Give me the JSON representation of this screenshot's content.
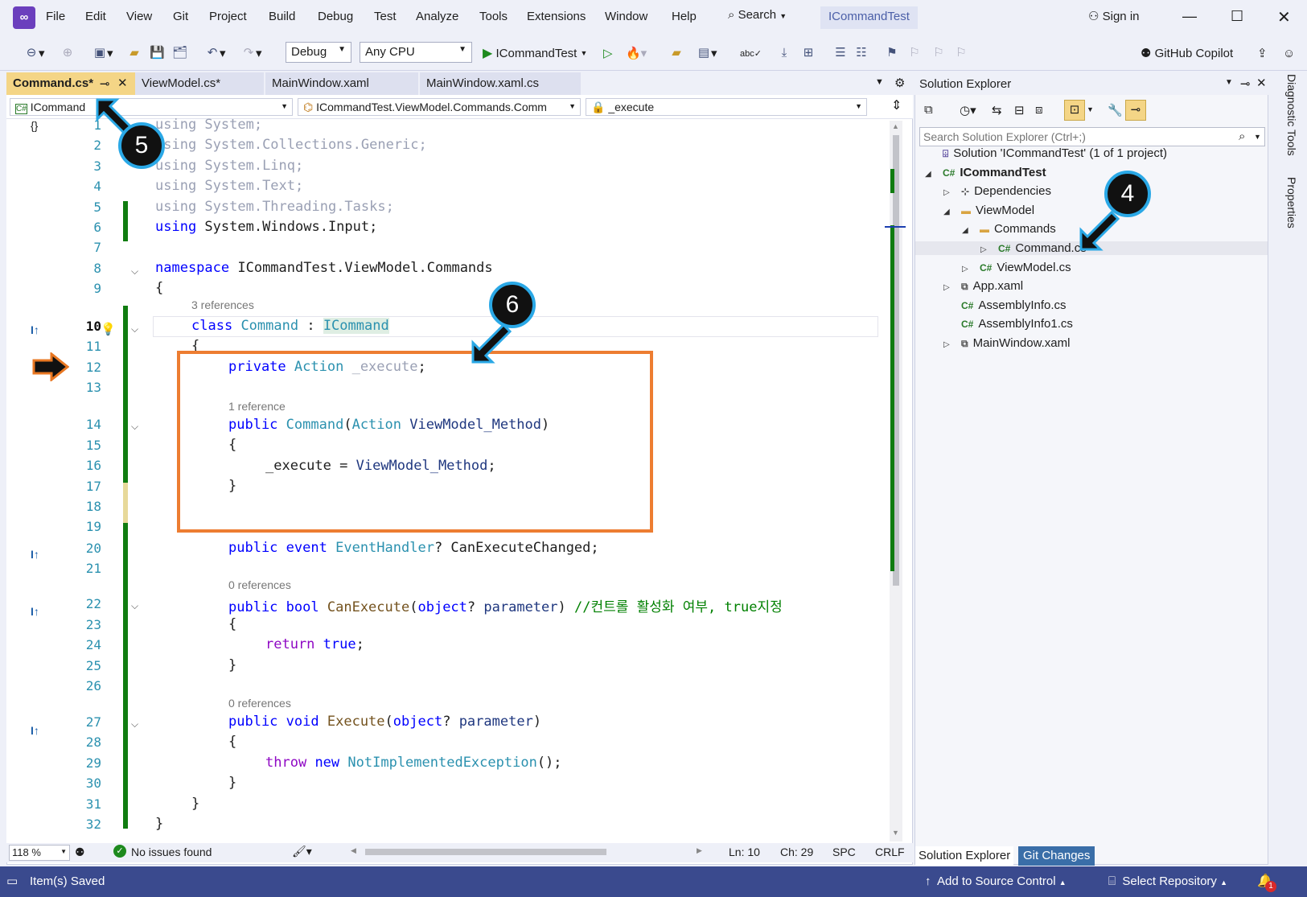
{
  "menu": [
    "File",
    "Edit",
    "View",
    "Git",
    "Project",
    "Build",
    "Debug",
    "Test",
    "Analyze",
    "Tools",
    "Extensions",
    "Window",
    "Help"
  ],
  "search_label": "Search",
  "project_title": "ICommandTest",
  "sign_in": "Sign in",
  "toolbar": {
    "config": "Debug",
    "platform": "Any CPU",
    "run_target": "ICommandTest",
    "copilot": "GitHub Copilot"
  },
  "tabs": [
    {
      "label": "Command.cs*",
      "active": true
    },
    {
      "label": "ViewModel.cs*",
      "active": false
    },
    {
      "label": "MainWindow.xaml",
      "active": false
    },
    {
      "label": "MainWindow.xaml.cs",
      "active": false
    }
  ],
  "navbar": {
    "project": "ICommand",
    "type": "ICommandTest.ViewModel.Commands.Comm",
    "member": "_execute"
  },
  "code": {
    "line_numbers": [
      "1",
      "2",
      "3",
      "4",
      "5",
      "6",
      "7",
      "8",
      "9",
      "10",
      "11",
      "12",
      "13",
      "14",
      "15",
      "16",
      "17",
      "18",
      "19",
      "20",
      "21",
      "22",
      "23",
      "24",
      "25",
      "26",
      "27",
      "28",
      "29",
      "30",
      "31",
      "32"
    ],
    "refs": {
      "class": "3 references",
      "ctor": "1 reference",
      "canexec": "0 references",
      "exec": "0 references"
    },
    "comment": "//컨트롤 활성화 여부, true지정"
  },
  "editor_status": {
    "zoom": "118 %",
    "issues": "No issues found",
    "ln": "Ln: 10",
    "ch": "Ch: 29",
    "spc": "SPC",
    "crlf": "CRLF"
  },
  "solution_explorer": {
    "title": "Solution Explorer",
    "search_placeholder": "Search Solution Explorer (Ctrl+;)",
    "items": [
      {
        "label": "Solution 'ICommandTest' (1 of 1 project)",
        "indent": 0,
        "icon": "solution-icon",
        "toggle": ""
      },
      {
        "label": "ICommandTest",
        "indent": 0,
        "icon": "csproj-icon",
        "toggle": "◢",
        "bold": true
      },
      {
        "label": "Dependencies",
        "indent": 1,
        "icon": "dependencies-icon",
        "toggle": "▷"
      },
      {
        "label": "ViewModel",
        "indent": 1,
        "icon": "folder-icon",
        "toggle": "◢"
      },
      {
        "label": "Commands",
        "indent": 2,
        "icon": "folder-icon",
        "toggle": "◢"
      },
      {
        "label": "Command.cs",
        "indent": 3,
        "icon": "csharp-file-icon",
        "toggle": "▷",
        "selected": true
      },
      {
        "label": "ViewModel.cs",
        "indent": 2,
        "icon": "csharp-file-icon",
        "toggle": "▷"
      },
      {
        "label": "App.xaml",
        "indent": 1,
        "icon": "xaml-file-icon",
        "toggle": "▷"
      },
      {
        "label": "AssemblyInfo.cs",
        "indent": 1,
        "icon": "csharp-file-icon",
        "toggle": ""
      },
      {
        "label": "AssemblyInfo1.cs",
        "indent": 1,
        "icon": "csharp-file-icon",
        "toggle": ""
      },
      {
        "label": "MainWindow.xaml",
        "indent": 1,
        "icon": "xaml-file-icon",
        "toggle": "▷"
      }
    ],
    "bottom_tabs": [
      "Solution Explorer",
      "Git Changes"
    ]
  },
  "side_tabs": [
    "Diagnostic Tools",
    "Properties"
  ],
  "status_bar": {
    "left": "Item(s) Saved",
    "source_control": "Add to Source Control",
    "repo": "Select Repository",
    "notifications": "1"
  },
  "callouts": [
    "5",
    "4",
    "6"
  ]
}
